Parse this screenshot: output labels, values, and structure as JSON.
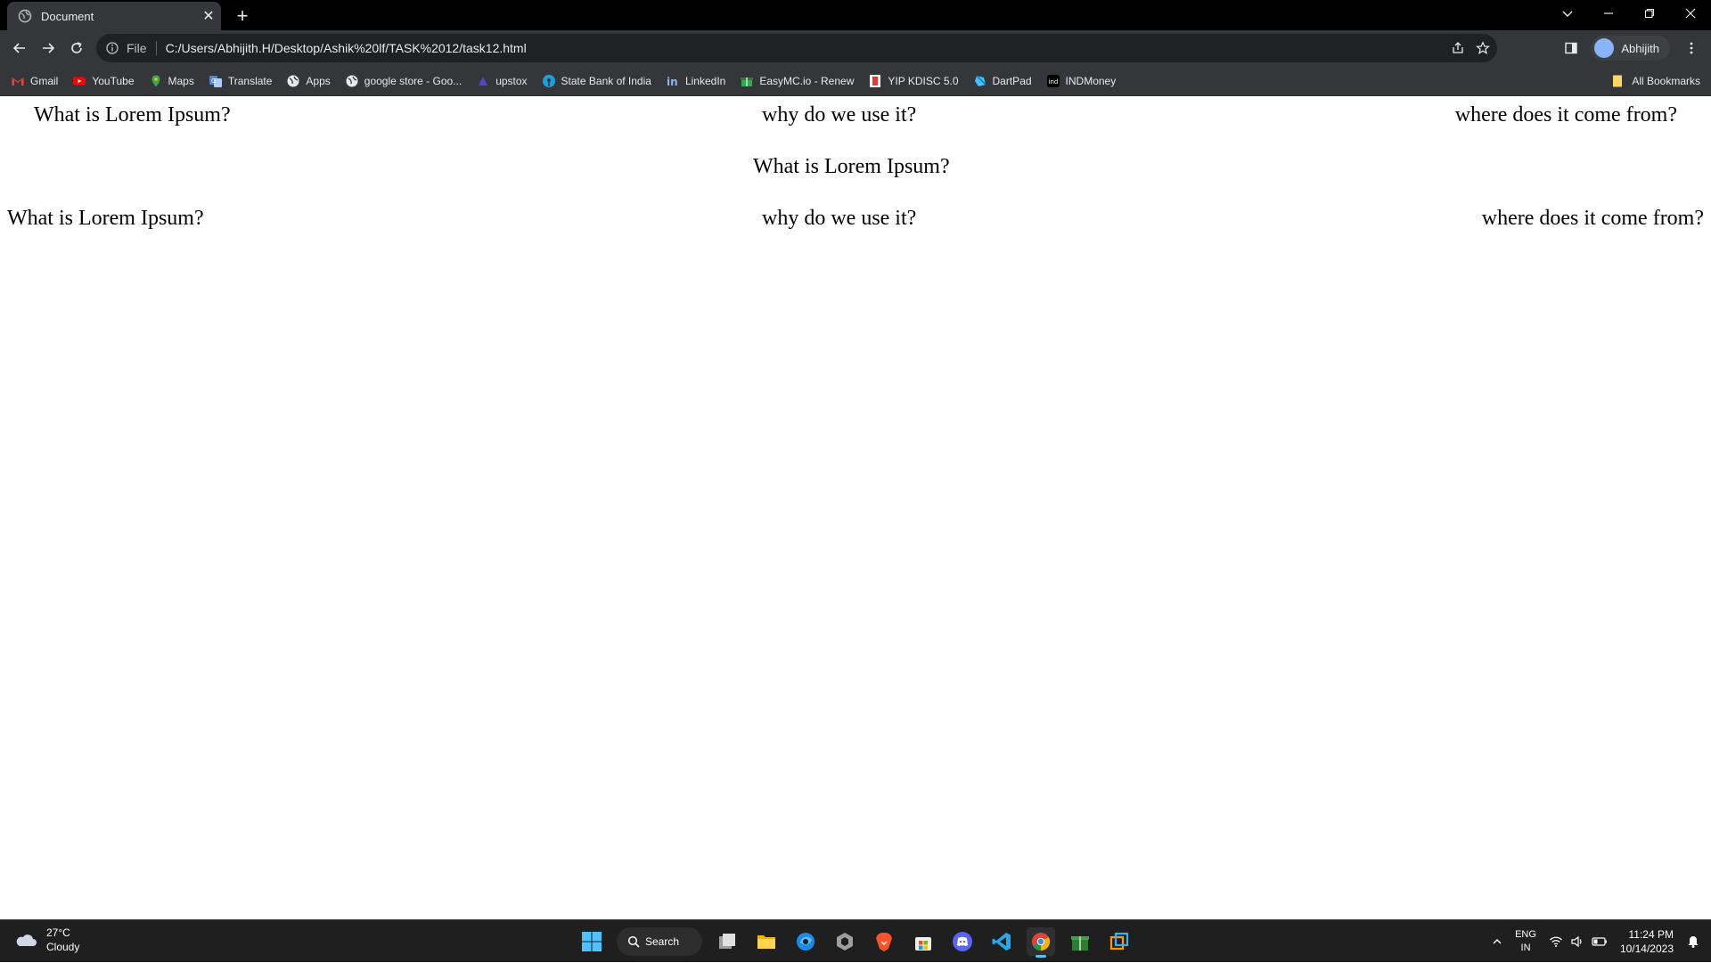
{
  "browser": {
    "tab_title": "Document",
    "omnibox_scheme": "File",
    "url": "C:/Users/Abhijith.H/Desktop/Ashik%20lf/TASK%2012/task12.html",
    "profile_name": "Abhijith"
  },
  "bookmarks": [
    {
      "label": "Gmail",
      "icon": "gmail-icon",
      "color": "#ea4335"
    },
    {
      "label": "YouTube",
      "icon": "youtube-icon",
      "color": "#ff0000"
    },
    {
      "label": "Maps",
      "icon": "maps-icon",
      "color": "#34a853"
    },
    {
      "label": "Translate",
      "icon": "translate-icon",
      "color": "#4285f4"
    },
    {
      "label": "Apps",
      "icon": "globe-icon",
      "color": "#e8eaed"
    },
    {
      "label": "google store - Goo...",
      "icon": "globe-icon",
      "color": "#e8eaed"
    },
    {
      "label": "upstox",
      "icon": "upstox-icon",
      "color": "#5a3fd6"
    },
    {
      "label": "State Bank of India",
      "icon": "sbi-icon",
      "color": "#1ba1e2"
    },
    {
      "label": "LinkedIn",
      "icon": "linkedin-icon",
      "color": "#8ab4f8"
    },
    {
      "label": "EasyMC.io - Renew",
      "icon": "gift-icon",
      "color": "#34a853"
    },
    {
      "label": "YIP KDISC 5.0",
      "icon": "yip-icon",
      "color": "#e53935"
    },
    {
      "label": "DartPad",
      "icon": "dart-icon",
      "color": "#40c4ff"
    },
    {
      "label": "INDMoney",
      "icon": "indmoney-icon",
      "color": "#ffffff"
    }
  ],
  "all_bookmarks_label": "All Bookmarks",
  "content": {
    "row1": [
      "What is Lorem Ipsum?",
      "why do we use it?",
      "where does it come from?"
    ],
    "row2": [
      "What is Lorem Ipsum?"
    ],
    "row3": [
      "What is Lorem Ipsum?",
      "why do we use it?",
      "where does it come from?"
    ]
  },
  "taskbar": {
    "temperature": "27°C",
    "condition": "Cloudy",
    "search_label": "Search",
    "lang_primary": "ENG",
    "lang_secondary": "IN",
    "time": "11:24 PM",
    "date": "10/14/2023"
  }
}
